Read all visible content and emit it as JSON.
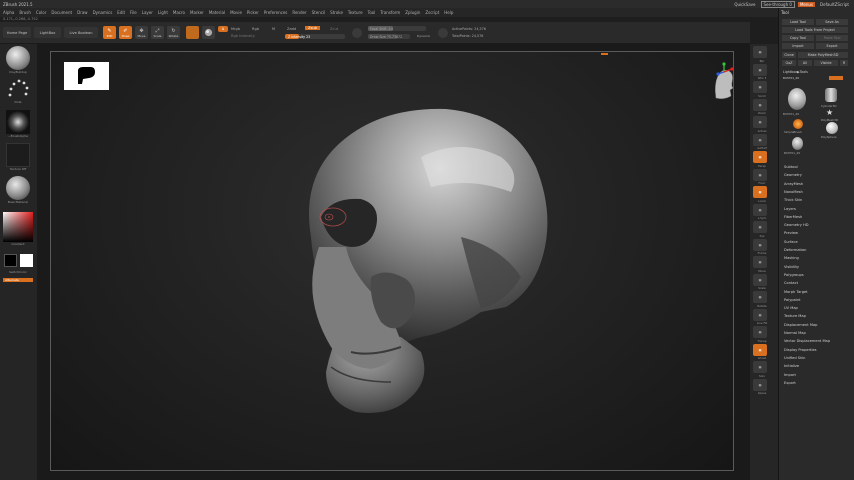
{
  "window": {
    "title": "ZBrush 2021.5",
    "quicksave": "QuickSave",
    "seethrough": "See-through",
    "seethrough_value": "0",
    "menus_label": "Menus",
    "default_script": "DefaultZScript"
  },
  "menubar": [
    "Alpha",
    "Brush",
    "Color",
    "Document",
    "Draw",
    "Dynamics",
    "Edit",
    "File",
    "Layer",
    "Light",
    "Macro",
    "Marker",
    "Material",
    "Movie",
    "Picker",
    "Preferences",
    "Render",
    "Stencil",
    "Stroke",
    "Texture",
    "Tool",
    "Transform",
    "Zplugin",
    "Zscript",
    "Help"
  ],
  "coords": "0.171,-0.266,-0.752",
  "shelf": {
    "home_page": "Home Page",
    "lightbox": "LightBox",
    "live_boolean": "Live Boolean",
    "tools": [
      {
        "label": "Edit",
        "on": true
      },
      {
        "label": "Draw",
        "on": true
      },
      {
        "label": "Move",
        "on": false
      },
      {
        "label": "Scale",
        "on": false
      },
      {
        "label": "Rotate",
        "on": false
      }
    ],
    "mrgb": "Mrgb",
    "rgb": "Rgb",
    "m": "M",
    "zadd": "Zadd",
    "zsub": "Zsub",
    "zcut": "Zcut",
    "rgb_intensity": "Rgb Intensity",
    "z_intensity_label": "Z Intensity",
    "z_intensity_value": "23",
    "focal_shift_label": "Focal Shift",
    "focal_shift_value": "-14",
    "draw_size_label": "Draw Size",
    "draw_size_value": "75.73872",
    "dynamic": "Dynamic",
    "active_points_label": "ActivePoints:",
    "active_points_value": "24,576",
    "total_points_label": "TotalPoints:",
    "total_points_value": "24,576",
    "z_intensity_fraction": 0.23,
    "focal_fraction": 0.43
  },
  "left_tray": {
    "brush_name": "ClayBuildup",
    "stroke_name": "Dots",
    "alpha_name": "~BrushAlpha",
    "texture_name": "Texture Off",
    "material_name": "BasicMaterial",
    "gradient_label": "Gradient",
    "switch_color": "SwitchColor",
    "alternate": "Alternate"
  },
  "right_icons": [
    {
      "label": "Bpr",
      "orange": false
    },
    {
      "label": "SPix 3",
      "orange": false
    },
    {
      "label": "Scroll",
      "orange": false
    },
    {
      "label": "Zoom",
      "orange": false
    },
    {
      "label": "Actual",
      "orange": false
    },
    {
      "label": "AAHalf",
      "orange": false
    },
    {
      "label": "Persp",
      "orange": true
    },
    {
      "label": "Floor",
      "orange": false
    },
    {
      "label": "Local",
      "orange": true
    },
    {
      "label": "L.Sym",
      "orange": false
    },
    {
      "label": "Xyz",
      "orange": false
    },
    {
      "label": "Frame",
      "orange": false
    },
    {
      "label": "Move",
      "orange": false
    },
    {
      "label": "Scale",
      "orange": false
    },
    {
      "label": "Rotate",
      "orange": false
    },
    {
      "label": "Line Fill",
      "orange": false
    },
    {
      "label": "Transp",
      "orange": false
    },
    {
      "label": "Ghost",
      "orange": true
    },
    {
      "label": "Solo",
      "orange": false
    },
    {
      "label": "Xpose",
      "orange": false
    }
  ],
  "tool_palette": {
    "title": "Tool",
    "load_tool": "Load Tool",
    "save_as": "Save As",
    "load_from_project": "Load Tools From Project",
    "copy_tool": "Copy Tool",
    "paste_tool": "Paste Tool",
    "import": "Import",
    "export": "Export",
    "clone": "Clone",
    "make_polymesh": "Make PolyMesh3D",
    "goz": "GoZ",
    "all": "All",
    "visible": "Visible",
    "r": "R",
    "lightbox_tools": "Lightbox▶Tools",
    "current_tool": "BUST01_49",
    "thumbs": [
      "BUST01_49",
      "Cylinder3D",
      "PolyMesh3D",
      "SimpleBrush",
      "PolySphere",
      "BUST01_49"
    ],
    "sections": [
      "Subtool",
      "Geometry",
      "ArrayMesh",
      "NanoMesh",
      "Thick Skin",
      "Layers",
      "FiberMesh",
      "Geometry HD",
      "Preview",
      "Surface",
      "Deformation",
      "Masking",
      "Visibility",
      "Polygroups",
      "Contact",
      "Morph Target",
      "Polypaint",
      "UV Map",
      "Texture Map",
      "Displacement Map",
      "Normal Map",
      "Vector Displacement Map",
      "Display Properties",
      "Unified Skin",
      "Initialize",
      "Import",
      "Export"
    ]
  }
}
